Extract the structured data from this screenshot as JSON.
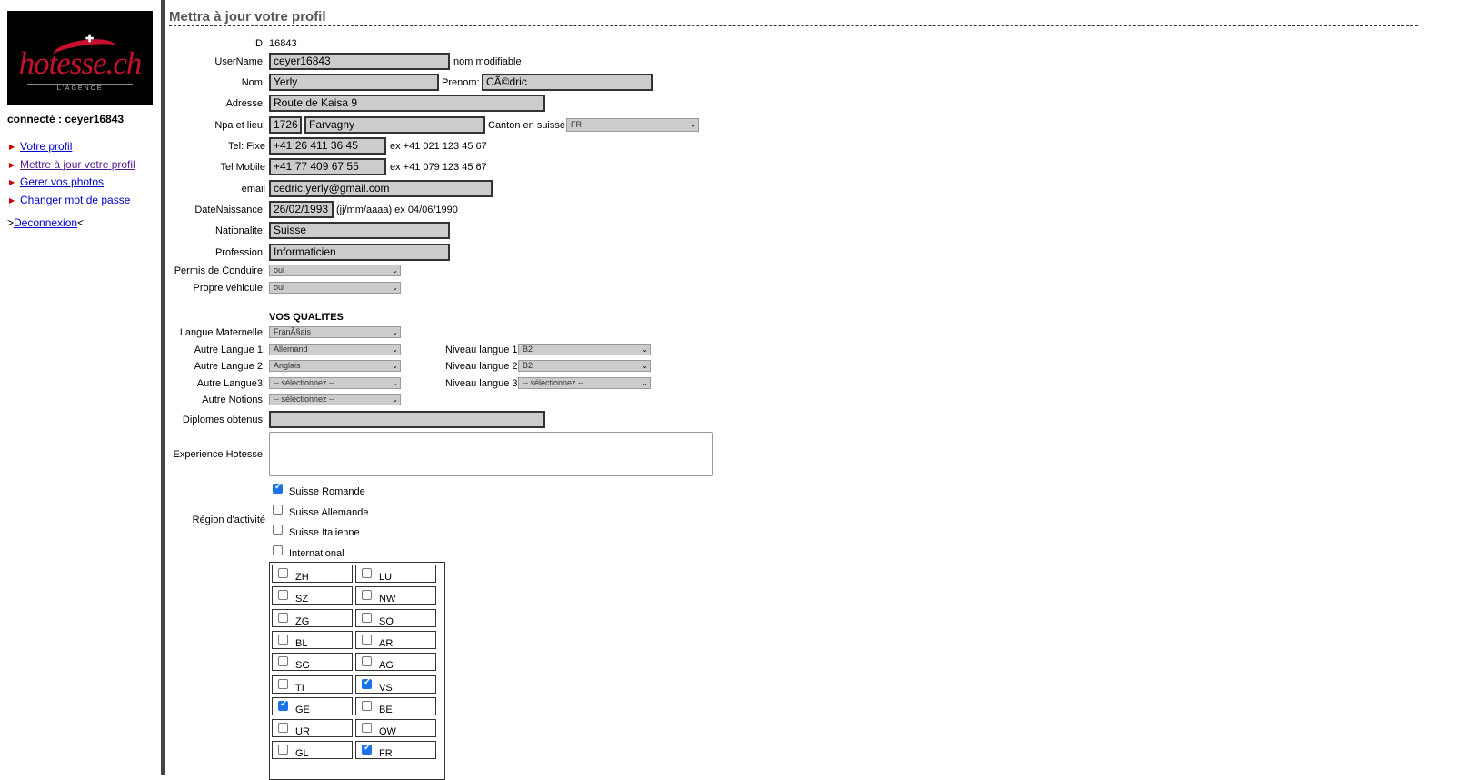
{
  "sidebar": {
    "logo_text": "hotesse.ch",
    "logo_tagline": "L'AGENCE",
    "connected_label": "connecté : ceyer16843",
    "menu": [
      {
        "label": "Votre profil"
      },
      {
        "label": "Mettre à jour votre profil"
      },
      {
        "label": "Gerer vos photos"
      },
      {
        "label": "Changer mot de passe"
      }
    ],
    "logout_prefix": ">",
    "logout_label": "Deconnexion",
    "logout_suffix": "<"
  },
  "page": {
    "title": "Mettra à jour votre profil"
  },
  "form": {
    "id_label": "ID:",
    "id_value": "16843",
    "username_label": "UserName:",
    "username_value": "ceyer16843",
    "username_note": "nom modifiable",
    "nom_label": "Nom:",
    "nom_value": "Yerly",
    "prenom_label": "Prenom:",
    "prenom_value": "CÃ©dric",
    "adresse_label": "Adresse:",
    "adresse_value": "Route de Kaisa 9",
    "npa_label": "Npa et lieu:",
    "npa_value": "1726",
    "lieu_value": "Farvagny",
    "canton_label": "Canton en suisse",
    "canton_value": "FR",
    "telfixe_label": "Tel: Fixe",
    "telfixe_value": "+41 26 411 36 45",
    "telfixe_hint": "ex +41 021 123 45 67",
    "telmobile_label": "Tel Mobile",
    "telmobile_value": "+41 77 409 67 55",
    "telmobile_hint": "ex +41 079 123 45 67",
    "email_label": "email",
    "email_value": "cedric.yerly@gmail.com",
    "dob_label": "DateNaissance:",
    "dob_value": "26/02/1993",
    "dob_hint": "(jj/mm/aaaa) ex 04/06/1990",
    "nationalite_label": "Nationalite:",
    "nationalite_value": "Suisse",
    "profession_label": "Profession:",
    "profession_value": "Informaticien",
    "permis_label": "Permis de Conduire:",
    "permis_value": "oui",
    "vehicule_label": "Propre véhicule:",
    "vehicule_value": "oui",
    "qualites_heading": "VOS QUALITES",
    "langue_mat_label": "Langue Maternelle:",
    "langue_mat_value": "FranÃ§ais",
    "langue1_label": "Autre Langue 1:",
    "langue1_value": "Allemand",
    "langue2_label": "Autre Langue 2:",
    "langue2_value": "Anglais",
    "langue3_label": "Autre Langue3:",
    "langue3_value": "-- sélectionnez --",
    "notions_label": "Autre Notions:",
    "notions_value": "-- sélectionnez --",
    "niveau1_label": "Niveau langue 1",
    "niveau1_value": "B2",
    "niveau2_label": "Niveau langue 2",
    "niveau2_value": "B2",
    "niveau3_label": "Niveau langue 3",
    "niveau3_value": "-- sélectionnez --",
    "diplomes_label": "Diplomes obtenus:",
    "diplomes_value": "",
    "experience_label": "Experience Hotesse:",
    "region_label": "Région d'activité",
    "regions": [
      {
        "label": "Suisse Romande",
        "checked": true
      },
      {
        "label": "Suisse Allemande",
        "checked": false
      },
      {
        "label": "Suisse Italienne",
        "checked": false
      },
      {
        "label": "International",
        "checked": false
      }
    ],
    "cantons": [
      [
        "ZH",
        false
      ],
      [
        "LU",
        false
      ],
      [
        "SZ",
        false
      ],
      [
        "NW",
        false
      ],
      [
        "ZG",
        false
      ],
      [
        "SO",
        false
      ],
      [
        "BL",
        false
      ],
      [
        "AR",
        false
      ],
      [
        "SG",
        false
      ],
      [
        "AG",
        false
      ],
      [
        "TI",
        false
      ],
      [
        "VS",
        true
      ],
      [
        "GE",
        true
      ],
      [
        "BE",
        false
      ],
      [
        "UR",
        false
      ],
      [
        "OW",
        false
      ],
      [
        "GL",
        false
      ],
      [
        "FR",
        true
      ]
    ]
  }
}
